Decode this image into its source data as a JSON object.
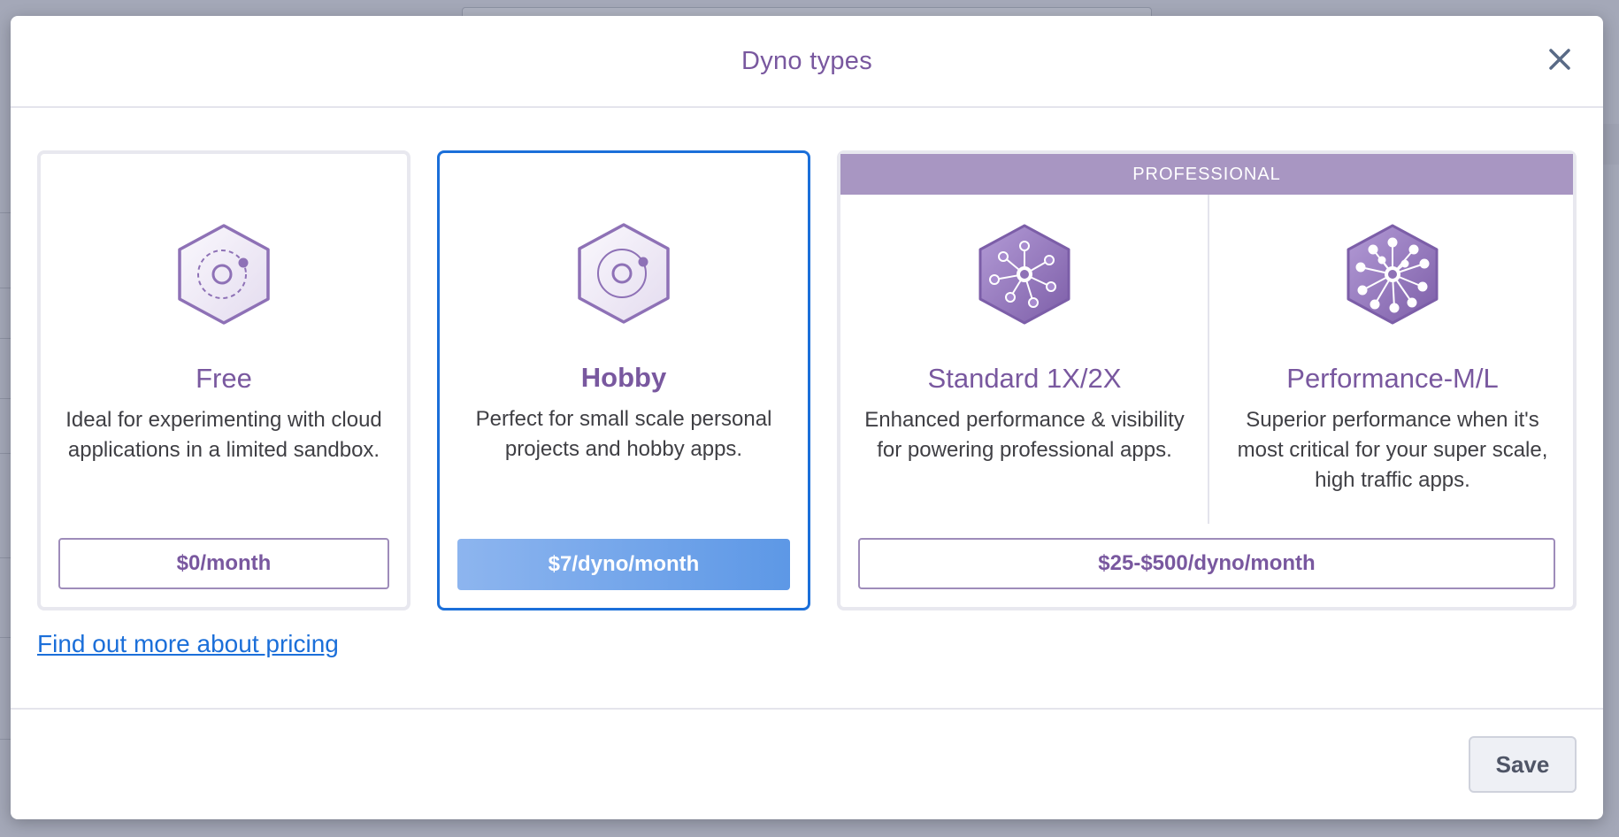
{
  "modal": {
    "title": "Dyno types",
    "close_icon": "close-icon"
  },
  "colors": {
    "accent_purple": "#79589f",
    "selected_border": "#1b6fd9",
    "professional_band": "#a896c2",
    "link": "#1b6fd9"
  },
  "tiers": {
    "free": {
      "icon": "hexagon-orbit-dashed-icon",
      "name": "Free",
      "description": "Ideal for experimenting with cloud applications in a limited sandbox.",
      "price": "$0/month"
    },
    "hobby": {
      "icon": "hexagon-orbit-icon",
      "name": "Hobby",
      "description": "Perfect for small scale personal projects and hobby apps.",
      "price": "$7/dyno/month",
      "selected": true
    },
    "professional": {
      "band_label": "PROFESSIONAL",
      "price": "$25-$500/dyno/month",
      "standard": {
        "icon": "hexagon-network-icon",
        "name": "Standard 1X/2X",
        "description": "Enhanced performance & visibility for powering professional apps."
      },
      "performance": {
        "icon": "hexagon-network-large-icon",
        "name": "Performance-M/L",
        "description": "Superior performance when it's most critical for your super scale, high traffic apps."
      }
    }
  },
  "links": {
    "pricing": "Find out more about pricing"
  },
  "footer": {
    "save_label": "Save"
  }
}
